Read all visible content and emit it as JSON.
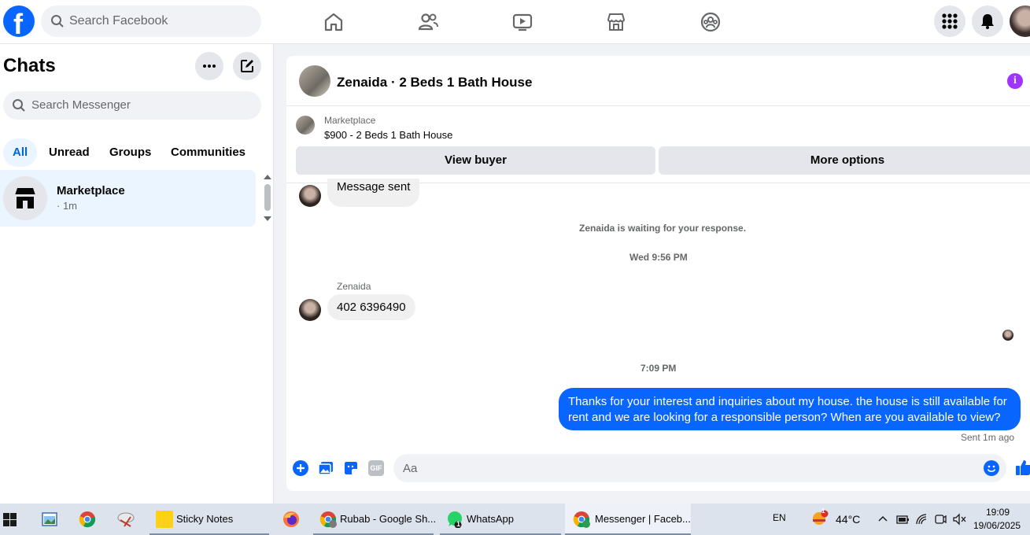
{
  "topbar": {
    "logo": "f",
    "search_placeholder": "Search Facebook",
    "nav_icons": [
      "home-icon",
      "friends-icon",
      "video-icon",
      "marketplace-icon",
      "groups-icon"
    ]
  },
  "chats": {
    "title": "Chats",
    "search_placeholder": "Search Messenger",
    "filters": [
      "All",
      "Unread",
      "Groups",
      "Communities"
    ],
    "active_filter": "All",
    "items": [
      {
        "name": "Marketplace",
        "meta": "· 1m"
      }
    ]
  },
  "conversation": {
    "title": "Zenaida · 2 Beds 1 Bath House",
    "marketplace": {
      "label": "Marketplace",
      "listing": "$900 - 2 Beds 1 Bath House",
      "view_buyer": "View buyer",
      "more_options": "More options"
    },
    "messages": {
      "prev_bubble": "Message sent",
      "waiting_notice": "Zenaida is waiting for your response.",
      "timestamp_1": "Wed 9:56 PM",
      "sender_name": "Zenaida",
      "incoming": "402 6396490",
      "timestamp_2": "7:09 PM",
      "outgoing": "Thanks for your interest and inquiries about my house. the house is still available for rent and we are looking for a responsible person? When are you available to view?",
      "sent_status": "Sent 1m ago"
    },
    "composer": {
      "placeholder": "Aa",
      "gif_label": "GIF"
    }
  },
  "taskbar": {
    "items": [
      {
        "label": "Sticky Notes"
      },
      {
        "label": "Rubab - Google Sh..."
      },
      {
        "label": "WhatsApp"
      },
      {
        "label": "Messenger | Faceb..."
      }
    ],
    "whatsapp_badge": "1",
    "language": "EN",
    "weather": "44°C",
    "weather_badge": "1",
    "time": "19:09",
    "date": "19/06/2025"
  },
  "colors": {
    "brand_blue": "#0866ff",
    "active_tab_bg": "#ebf5ff",
    "info_purple": "#a033ff"
  }
}
